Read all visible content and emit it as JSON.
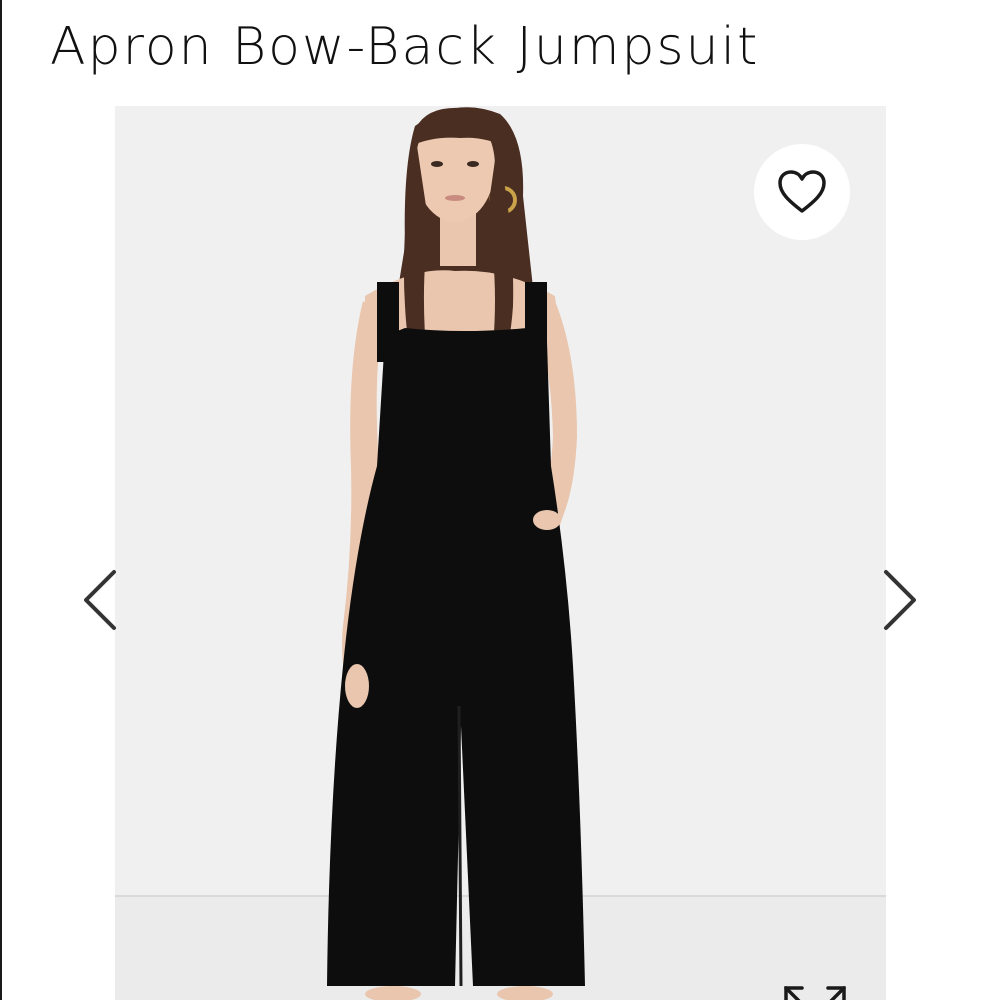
{
  "product": {
    "title": "Apron Bow-Back Jumpsuit"
  },
  "gallery": {
    "image_alt": "Model wearing black Apron Bow-Back Jumpsuit",
    "prev_icon": "chevron-left-icon",
    "next_icon": "chevron-right-icon",
    "favorite_icon": "heart-outline-icon",
    "expand_icon": "expand-arrows-icon"
  },
  "colors": {
    "text": "#111111",
    "photo_background": "#f0f0f0",
    "garment": "#0d0d0d",
    "hair": "#4a2e22",
    "skin": "#e9c6ad",
    "earring": "#c9a24a"
  }
}
